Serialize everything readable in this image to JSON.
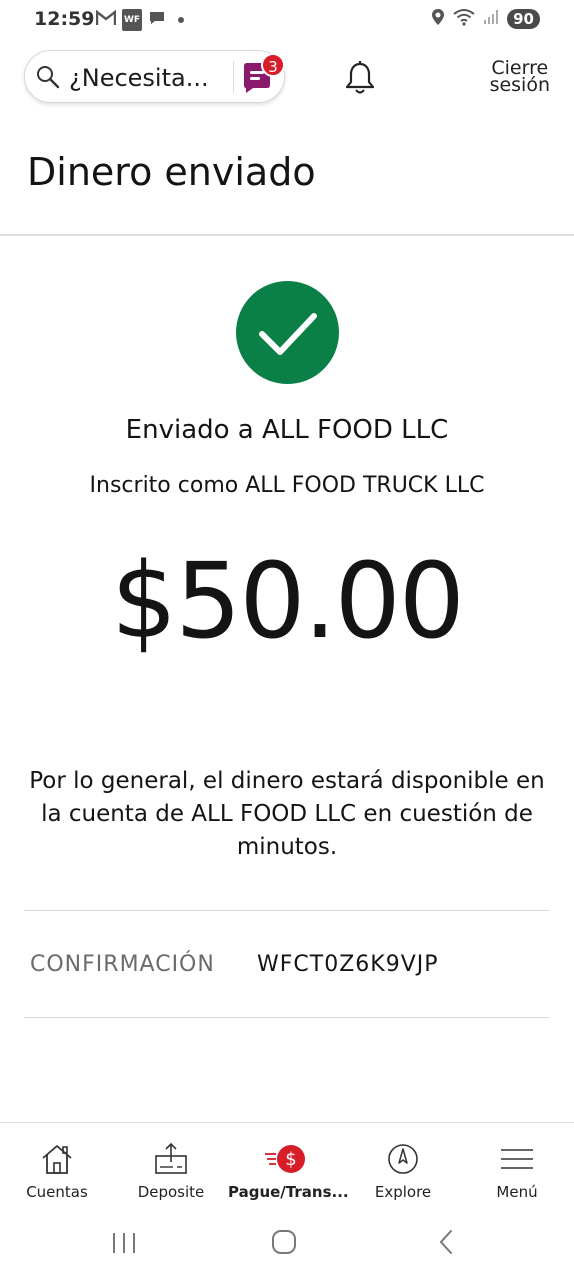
{
  "status_bar": {
    "time": "12:59",
    "wf_badge": "WF",
    "battery": "90"
  },
  "header": {
    "search_placeholder": "¿Necesita...",
    "chat_badge_count": "3",
    "logout_line1": "Cierre",
    "logout_line2": "sesión"
  },
  "page": {
    "title": "Dinero enviado",
    "sent_to": "Enviado a ALL FOOD LLC",
    "enrolled_as": "Inscrito como ALL FOOD TRUCK LLC",
    "amount": "$50.00",
    "availability_message": "Por lo general, el dinero estará disponible en la cuenta de ALL FOOD LLC en cuestión de minutos.",
    "confirmation_label": "CONFIRMACIÓN",
    "confirmation_value": "WFCT0Z6K9VJP"
  },
  "bottom_nav": {
    "items": [
      {
        "label": "Cuentas",
        "icon": "house-icon",
        "active": false
      },
      {
        "label": "Deposite",
        "icon": "deposit-icon",
        "active": false
      },
      {
        "label": "Pague/Trans...",
        "icon": "pay-transfer-icon",
        "active": true
      },
      {
        "label": "Explore",
        "icon": "compass-icon",
        "active": false
      },
      {
        "label": "Menú",
        "icon": "hamburger-menu-icon",
        "active": false
      }
    ]
  },
  "colors": {
    "success_green": "#0a7f46",
    "brand_red": "#d71e28",
    "chat_purple": "#8a1a6b"
  }
}
